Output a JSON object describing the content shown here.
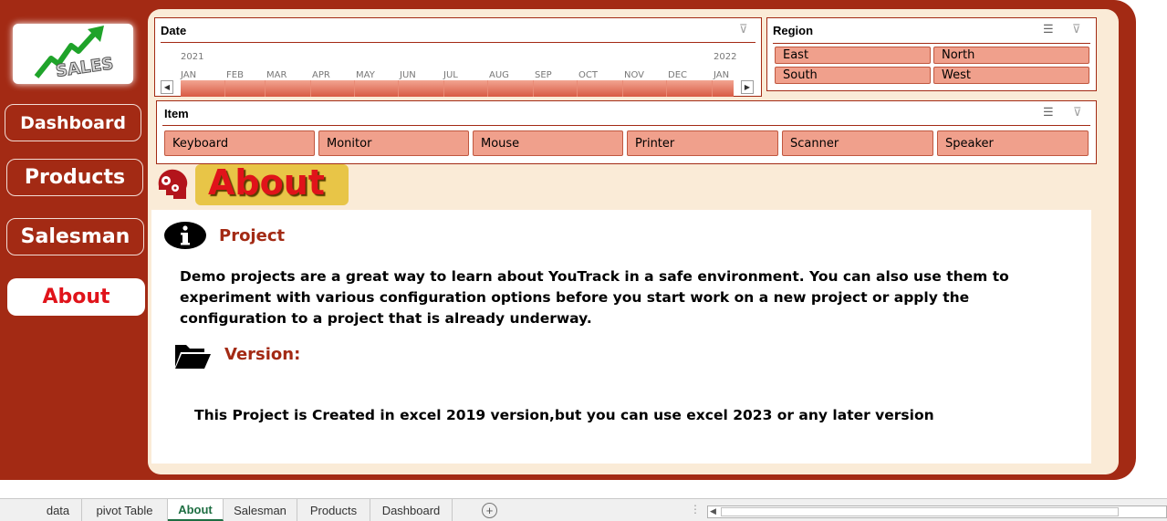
{
  "logo": {
    "text": "SALES"
  },
  "nav": {
    "dashboard": "Dashboard",
    "products": "Products",
    "salesman": "Salesman",
    "about": "About"
  },
  "date_slicer": {
    "title": "Date",
    "year_start": "2021",
    "year_end": "2022",
    "months": [
      "JAN",
      "FEB",
      "MAR",
      "APR",
      "MAY",
      "JUN",
      "JUL",
      "AUG",
      "SEP",
      "OCT",
      "NOV",
      "DEC",
      "JAN"
    ]
  },
  "region_slicer": {
    "title": "Region",
    "items": [
      "East",
      "North",
      "South",
      "West"
    ]
  },
  "item_slicer": {
    "title": "Item",
    "items": [
      "Keyboard",
      "Monitor",
      "Mouse",
      "Printer",
      "Scanner",
      "Speaker"
    ]
  },
  "page_title": "About",
  "project": {
    "heading": "Project",
    "text": "Demo projects are a great way to learn about YouTrack in a safe environment. You can also use them to experiment with various configuration options before you start work on a new project or apply the configuration to a project that is already underway."
  },
  "version": {
    "heading": "Version:",
    "text": "This Project is Created in excel 2019 version,but you can use excel 2023 or any later version"
  },
  "sheet_tabs": [
    "data",
    "pivot Table",
    "About",
    "Salesman",
    "Products",
    "Dashboard"
  ],
  "active_tab": "About",
  "colors": {
    "frame": "#a32a14",
    "panel": "#faebd7",
    "slicer_item": "#f0a08c",
    "title_badge": "#e8c547",
    "title_text": "#e0131a"
  }
}
